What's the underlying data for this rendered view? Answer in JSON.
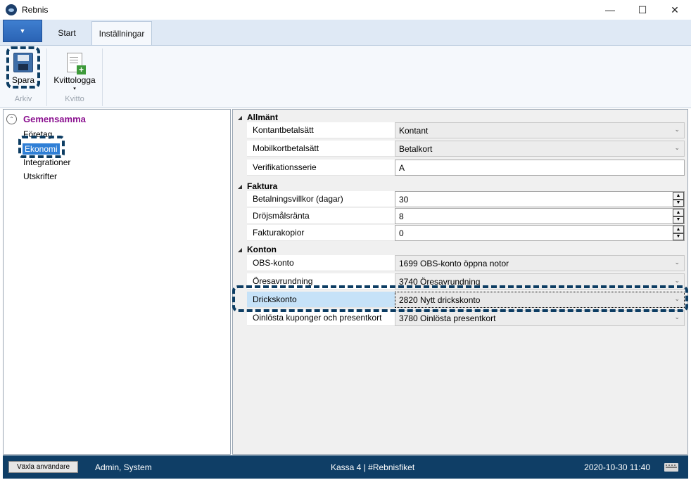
{
  "window": {
    "title": "Rebnis",
    "minimize": "—",
    "maximize": "☐",
    "close": "✕"
  },
  "ribbon": {
    "app_menu_icon": "▼",
    "tabs": [
      {
        "label": "Start"
      },
      {
        "label": "Inställningar"
      }
    ],
    "groups": [
      {
        "label": "Arkiv",
        "button": {
          "label": "Spara",
          "icon": "floppy-disk-icon"
        }
      },
      {
        "label": "Kvitto",
        "button": {
          "label": "Kvittologga",
          "icon": "receipt-add-icon",
          "dropdown": "▾"
        }
      }
    ]
  },
  "sidebar": {
    "group_title": "Gemensamma",
    "collapse_icon": "⌃",
    "items": [
      {
        "label": "Företag"
      },
      {
        "label": "Ekonomi",
        "selected": true
      },
      {
        "label": "Integrationer"
      },
      {
        "label": "Utskrifter"
      }
    ]
  },
  "properties": {
    "categories": [
      {
        "title": "Allmänt",
        "rows": [
          {
            "name": "Kontantbetalsätt",
            "value": "Kontant",
            "type": "select"
          },
          {
            "name": "Mobilkortbetalsätt",
            "value": "Betalkort",
            "type": "select"
          },
          {
            "name": "Verifikationsserie",
            "value": "A",
            "type": "text"
          }
        ]
      },
      {
        "title": "Faktura",
        "rows": [
          {
            "name": "Betalningsvillkor (dagar)",
            "value": "30",
            "type": "spin"
          },
          {
            "name": "Dröjsmålsränta",
            "value": "8",
            "type": "spin"
          },
          {
            "name": "Fakturakopior",
            "value": "0",
            "type": "spin"
          }
        ]
      },
      {
        "title": "Konton",
        "rows": [
          {
            "name": "OBS-konto",
            "value": "1699 OBS-konto öppna notor",
            "type": "select"
          },
          {
            "name": "Öresavrundning",
            "value": "3740 Öresavrundning",
            "type": "select"
          },
          {
            "name": "Drickskonto",
            "value": "2820 Nytt drickskonto",
            "type": "select",
            "selected": true
          },
          {
            "name": "Oinlösta kuponger och presentkort",
            "value": "3780 Oinlösta presentkort",
            "type": "select"
          }
        ]
      }
    ]
  },
  "statusbar": {
    "switch_user_label": "Växla användare",
    "user": "Admin, System",
    "register": "Kassa 4 | #Rebnisfiket",
    "datetime": "2020-10-30 11:40",
    "keyboard_icon": "keyboard-icon"
  },
  "colors": {
    "accent": "#0f3e66",
    "group_title": "#8a0f8f",
    "selection": "#2f7fd6"
  }
}
